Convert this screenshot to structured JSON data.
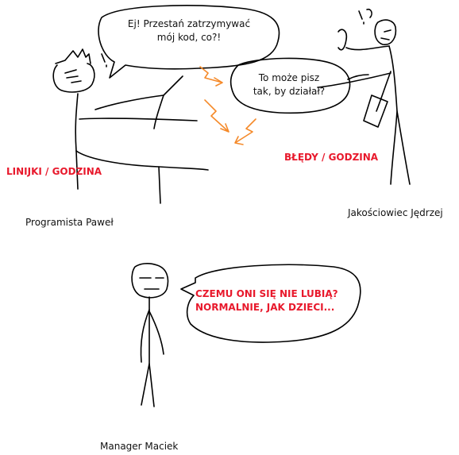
{
  "colors": {
    "ink": "#000000",
    "label_red": "#e8192c",
    "arrow_orange": "#f58a2a",
    "background": "#ffffff"
  },
  "speech": {
    "pawel_line1": "Ej! Przestań zatrzymywać",
    "pawel_line2": "mój kod, co?!",
    "jedrzej_line1": "To może pisz",
    "jedrzej_line2": "tak, by działał?",
    "maciek_line1": "CZEMU ONI SIĘ NIE LUBIĄ?",
    "maciek_line2": "NORMALNIE, JAK DZIECI..."
  },
  "labels": {
    "pawel_metric": "LINIJKI / GODZINA",
    "jedrzej_metric": "BŁĘDY / GODZINA"
  },
  "characters": {
    "pawel_name": "Programista Paweł",
    "jedrzej_name": "Jakościowiec Jędrzej",
    "maciek_name": "Manager Maciek"
  },
  "marks": {
    "exclamation": "!",
    "question": "?"
  }
}
